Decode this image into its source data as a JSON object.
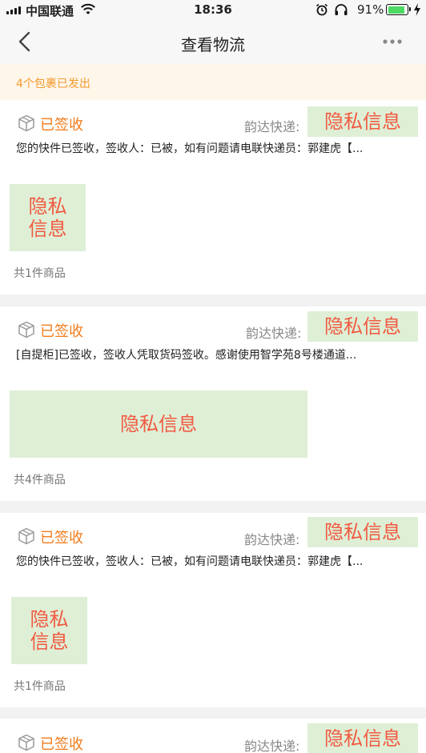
{
  "status_bar": {
    "carrier": "中国联通",
    "time": "18:36",
    "battery": "91%",
    "battery_level": 0.91
  },
  "nav": {
    "title": "查看物流"
  },
  "notice": "4个包裹已发出",
  "privacy_text": "隐私信息",
  "privacy_text_wrapped": "隐私\n信息",
  "packages": [
    {
      "status": "已签收",
      "carrier_label": "韵达快递:",
      "message": "您的快件已签收，签收人：已被，如有问题请电联快递员：郭建虎【...",
      "item_count": "共1件商品"
    },
    {
      "status": "已签收",
      "carrier_label": "韵达快递:",
      "message": "[自提柜]已签收，签收人凭取货码签收。感谢使用智学苑8号楼通道...",
      "item_count": "共4件商品"
    },
    {
      "status": "已签收",
      "carrier_label": "韵达快递:",
      "message": "您的快件已签收，签收人：已被，如有问题请电联快递员：郭建虎【...",
      "item_count": "共1件商品"
    },
    {
      "status": "已签收",
      "carrier_label": "韵达快递:"
    }
  ],
  "colors": {
    "accent": "#f27c1c",
    "notice_text": "#f29b2e",
    "notice_bg": "#fff6ea",
    "privacy_bg": "#deefd6",
    "privacy_text": "#f15a41"
  }
}
